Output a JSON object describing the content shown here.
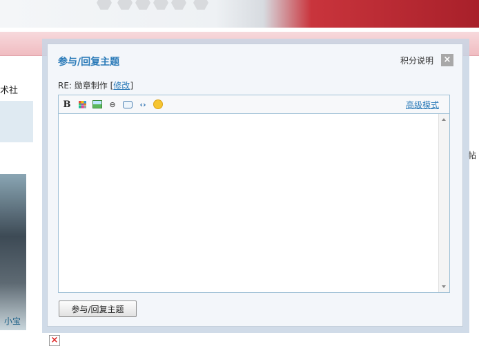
{
  "background": {
    "club_text": "术社",
    "avatar_name": "小宝",
    "right_text": "帖"
  },
  "dialog": {
    "title": "参与/回复主题",
    "help_link": "积分说明",
    "close": "×",
    "subject_text": "RE: 勋章制作",
    "bracket_open": "[",
    "edit_link": "修改",
    "bracket_close": "]",
    "toolbar": {
      "bold": "B",
      "link": "⊖",
      "code": "‹›",
      "advanced_mode": "高级模式"
    },
    "editor_value": "",
    "submit_label": "参与/回复主题"
  },
  "colors": {
    "accent": "#2a7ab8",
    "dialog_bg": "#f3f6fa"
  }
}
